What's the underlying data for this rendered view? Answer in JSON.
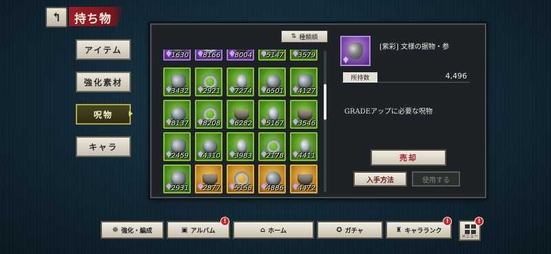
{
  "header": {
    "title": "持ち物",
    "back_icon": "back-arrow-icon"
  },
  "nav": {
    "items": [
      {
        "label": "アイテム",
        "active": false
      },
      {
        "label": "強化素材",
        "active": false
      },
      {
        "label": "呪物",
        "active": true
      },
      {
        "label": "キャラ",
        "active": false
      }
    ]
  },
  "sort": {
    "label": "種類順",
    "icon": "sort-icon"
  },
  "grid": {
    "rows": [
      [
        "1630",
        "8166",
        "8004",
        "5147",
        "3579"
      ],
      [
        "3432",
        "2921",
        "7274",
        "6501",
        "4127"
      ],
      [
        "8137",
        "8208",
        "6282",
        "5167",
        "3546"
      ],
      [
        "2459",
        "4310",
        "3983",
        "2178",
        "4411"
      ],
      [
        "2931",
        "2877",
        "5158",
        "4886",
        "4472"
      ]
    ]
  },
  "detail": {
    "name": "[紫彩] 文様の据物・参",
    "qty_label": "所持数",
    "qty_value": "4,496",
    "description": "GRADEアップに必要な呪物",
    "sell_label": "売却",
    "acquire_label": "入手方法",
    "use_label": "使用する"
  },
  "bottom": {
    "items": [
      {
        "label": "強化・編成",
        "icon": "enhance-icon",
        "badge": ""
      },
      {
        "label": "アルバム",
        "icon": "album-icon",
        "badge": "!"
      },
      {
        "label": "ホーム",
        "icon": "home-icon",
        "badge": ""
      },
      {
        "label": "ガチャ",
        "icon": "gacha-icon",
        "badge": ""
      },
      {
        "label": "キャラランク",
        "icon": "rank-icon",
        "badge": "!"
      }
    ],
    "menu_label": "メニュー",
    "menu_badge": "!"
  },
  "colors": {
    "accent_red": "#9b1e26",
    "grade_green": "#8cbf3c",
    "grade_gold": "#e0b040",
    "grade_purple": "#a77ad0"
  }
}
